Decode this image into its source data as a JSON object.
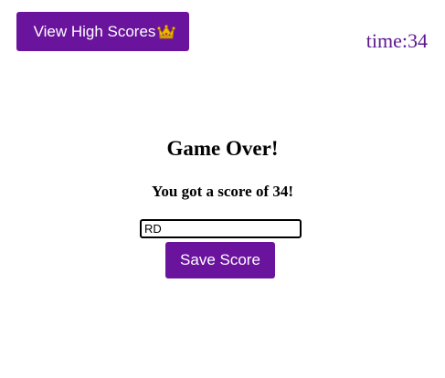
{
  "header": {
    "high_scores_label": "View High Scores",
    "high_scores_icon": "crown-icon",
    "timer_text": "time:34"
  },
  "result": {
    "title": "Game Over!",
    "score_message": "You got a score of 34!"
  },
  "form": {
    "initials_value": "RD",
    "save_label": "Save Score"
  },
  "colors": {
    "accent": "#6a149d",
    "timer": "#5b1690",
    "crown_gold": "#f5b800"
  }
}
